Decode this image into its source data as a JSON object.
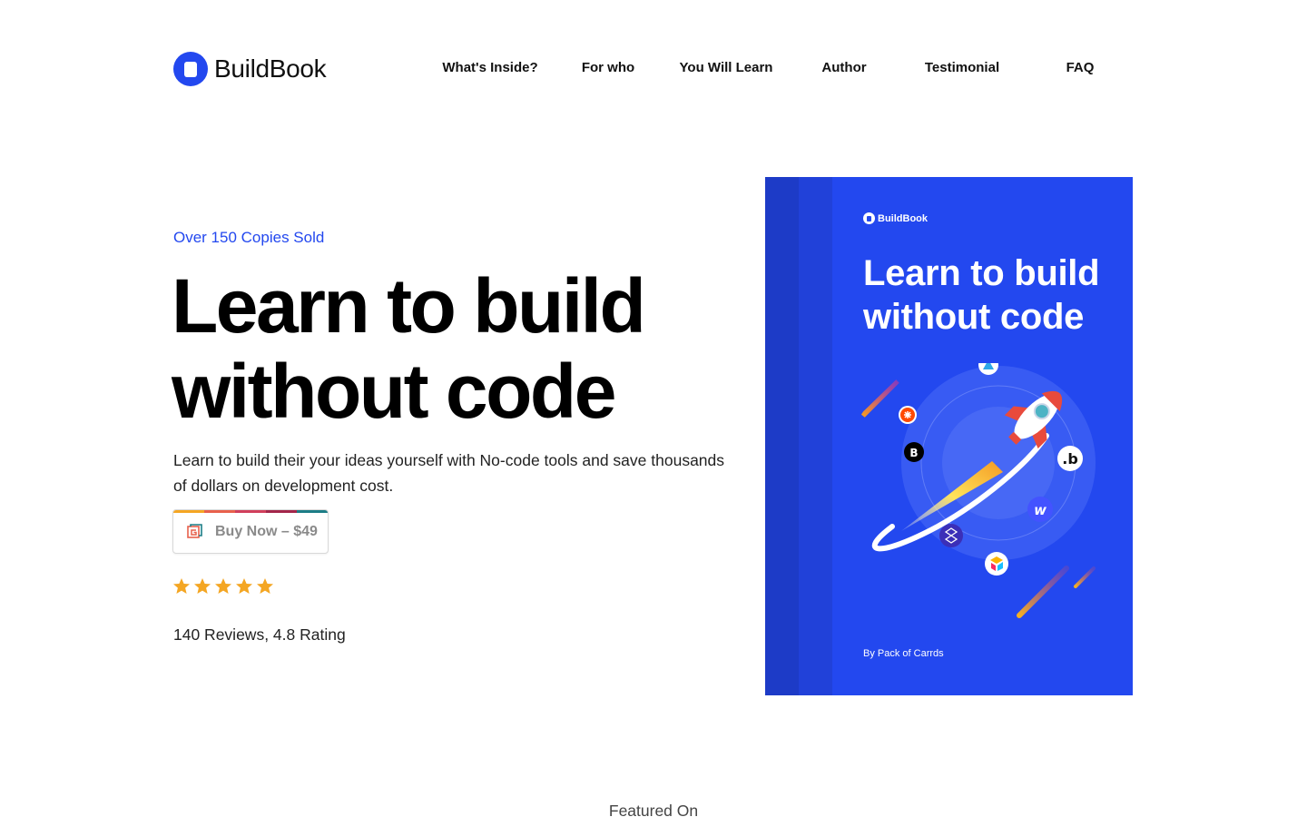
{
  "brand": {
    "name": "BuildBook",
    "logo_icon": "book-logo-icon",
    "accent": "#2348ef"
  },
  "nav": {
    "items": [
      {
        "label": "What's Inside?"
      },
      {
        "label": "For who"
      },
      {
        "label": "You Will Learn"
      },
      {
        "label": "Author"
      },
      {
        "label": "Testimonial"
      },
      {
        "label": "FAQ"
      }
    ]
  },
  "hero": {
    "eyebrow": "Over 150 Copies Sold",
    "headline_line1": "Learn to build",
    "headline_line2": "without code",
    "subtext": "Learn to build their your ideas yourself with No-code tools and save thousands of dollars on development cost.",
    "buy_button": {
      "label": "Buy Now – $49",
      "icon": "gumroad-icon"
    },
    "rating": {
      "stars": 5,
      "value": 4.8,
      "star_color": "#f4a623"
    },
    "reviews_text": "140 Reviews, 4.8 Rating"
  },
  "book": {
    "brand": "BuildBook",
    "title_line1": "Learn to build",
    "title_line2": "without code",
    "author": "By Pack of Carrds",
    "cover_color": "#2348ef",
    "art": "rocket-orbit-illustration"
  },
  "featured": {
    "label": "Featured On"
  }
}
